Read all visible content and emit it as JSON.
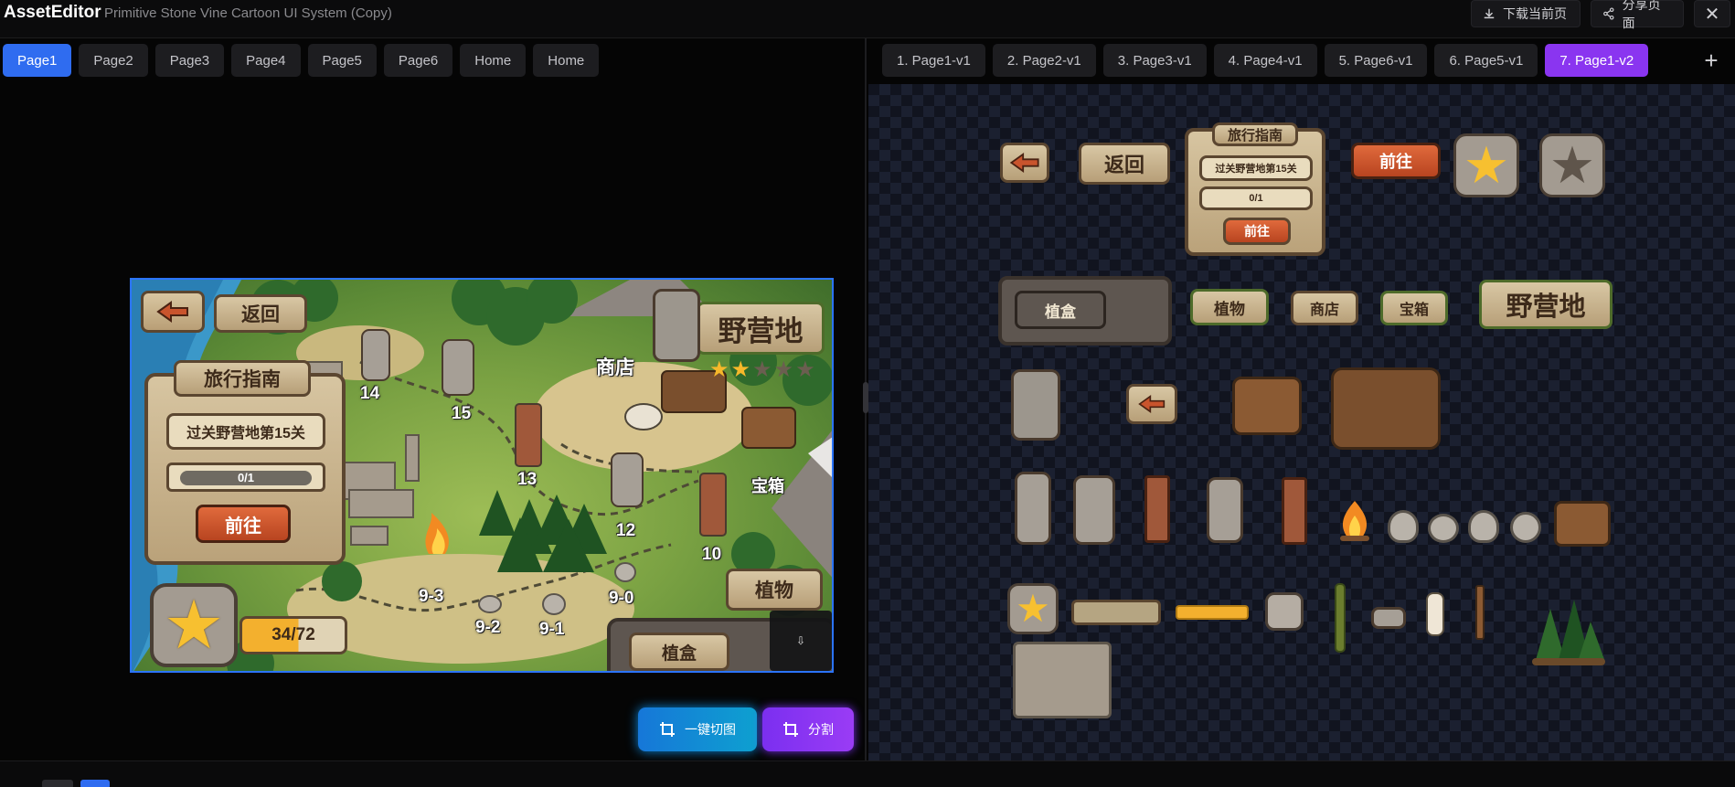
{
  "app": {
    "name": "AssetEditor",
    "document_title": "Primitive Stone Vine Cartoon UI System (Copy)"
  },
  "header": {
    "download_label": "下载当前页",
    "share_label": "分享页面",
    "close_label": "✕"
  },
  "tabs_left": [
    {
      "label": "Page1",
      "active": true
    },
    {
      "label": "Page2"
    },
    {
      "label": "Page3"
    },
    {
      "label": "Page4"
    },
    {
      "label": "Page5"
    },
    {
      "label": "Page6"
    },
    {
      "label": "Home"
    },
    {
      "label": "Home"
    }
  ],
  "tabs_right": [
    {
      "label": "1. Page1-v1"
    },
    {
      "label": "2. Page2-v1"
    },
    {
      "label": "3. Page3-v1"
    },
    {
      "label": "4. Page4-v1"
    },
    {
      "label": "5. Page6-v1"
    },
    {
      "label": "6. Page5-v1"
    },
    {
      "label": "7. Page1-v2",
      "active": true
    }
  ],
  "add_tab_label": "+",
  "preview": {
    "back_label": "返回",
    "camp_label": "野营地",
    "shop_label": "商店",
    "chest_label": "宝箱",
    "guide": {
      "title": "旅行指南",
      "subtitle": "过关野营地第15关",
      "progress": "0/1",
      "go_label": "前往"
    },
    "plants_label": "植物",
    "planter_label": "植盒",
    "score": "34/72",
    "stars_filled": 2,
    "stars_total": 5,
    "levels": [
      "14",
      "15",
      "13",
      "12",
      "10",
      "9-3",
      "9-2",
      "9-1",
      "9-0"
    ],
    "download_icon": "⇩"
  },
  "actions": {
    "cut_label": "一键切图",
    "split_label": "分割"
  },
  "sprites": {
    "back_label": "返回",
    "guide_title": "旅行指南",
    "guide_subtitle": "过关野营地第15关",
    "guide_progress": "0/1",
    "guide_go": "前往",
    "go_label": "前往",
    "planter_label": "植盒",
    "plants_label": "植物",
    "shop_label": "商店",
    "chest_label": "宝箱",
    "camp_label": "野营地"
  },
  "colors": {
    "accent_blue": "#2f6cf0",
    "accent_purple": "#8a35f0",
    "stone": "#cdb993",
    "wood_orange": "#c9542d"
  }
}
